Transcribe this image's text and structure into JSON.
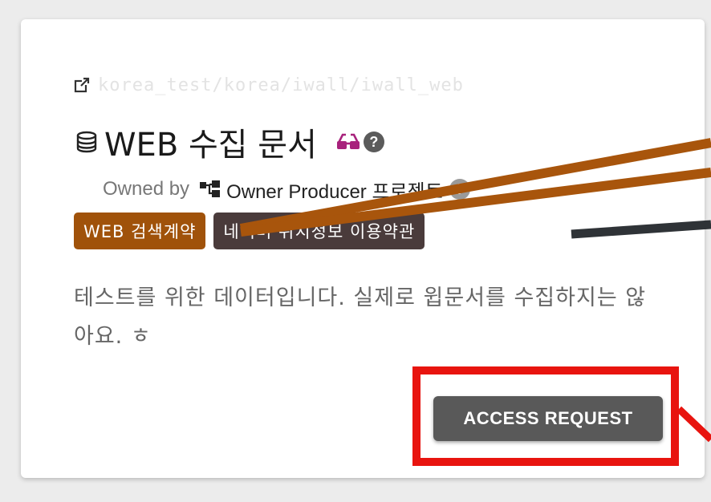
{
  "card": {
    "path": "korea_test/korea/iwall/iwall_web",
    "title": "WEB 수집 문서",
    "owned_by_label": "Owned by",
    "owner_name": "Owner Producer 프로젝트",
    "tags": [
      {
        "label": "WEB 검색계약",
        "color": "#a0520a"
      },
      {
        "label": "네이버 위치정보 이용약관",
        "color": "#4a3b3b"
      }
    ],
    "description": "테스트를 위한 데이터입니다. 실제로 윕문서를 수집하지는 않아요. ㅎ",
    "access_button_label": "ACCESS REQUEST"
  },
  "icons": {
    "external_link": "external-link-icon",
    "database": "database-icon",
    "glasses": "glasses-icon",
    "help": "help-icon",
    "organization": "org-icon"
  },
  "colors": {
    "annotation_orange": "#a8550c",
    "annotation_dark": "#2f3337",
    "highlight_red": "#e8140f",
    "button_bg": "#595959"
  }
}
